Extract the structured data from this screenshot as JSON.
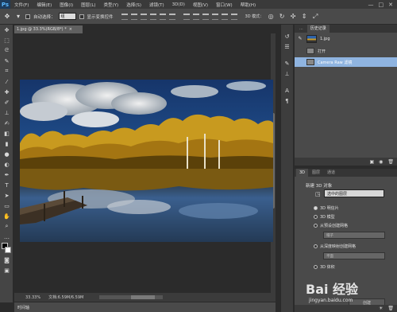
{
  "app": {
    "logo": "Ps"
  },
  "menu": [
    "文件(F)",
    "编辑(E)",
    "图像(I)",
    "图层(L)",
    "类型(Y)",
    "选择(S)",
    "滤镜(T)",
    "3D(D)",
    "视图(V)",
    "窗口(W)",
    "帮助(H)"
  ],
  "window_controls": [
    "—",
    "□",
    "✕"
  ],
  "options": {
    "auto_select_label": "自动选择：",
    "auto_select_value": "组",
    "show_transform_label": "显示变换控件",
    "mode3d_label": "3D 模式："
  },
  "document": {
    "tab_title": "1.jpg @ 33.3%(RGB/8*) *",
    "zoom": "33.33%",
    "doc_info": "文档:6.59M/6.59M"
  },
  "timeline": {
    "label": "时间轴"
  },
  "history": {
    "tabs": [
      "历史记录",
      "..."
    ],
    "snapshot_label": "1.jpg",
    "steps": [
      "打开",
      "Camera Raw 滤镜"
    ]
  },
  "panel3d": {
    "tabs": [
      "3D",
      "图层",
      "通道"
    ],
    "new_object_label": "新建 3D 对象",
    "source_select": "选中的图层",
    "options": [
      "3D 明信片",
      "3D 模型",
      "从预设创建网格",
      "从深度映射创建网格",
      "3D 体积"
    ],
    "preset_placeholder": "帽子",
    "depth_placeholder": "平面",
    "create_button": "创建"
  },
  "watermark": {
    "main": "Bai 经验",
    "sub": "jingyan.baidu.com"
  },
  "colors": {
    "accent": "#2f6fb8",
    "selection": "#8fb4e0"
  }
}
